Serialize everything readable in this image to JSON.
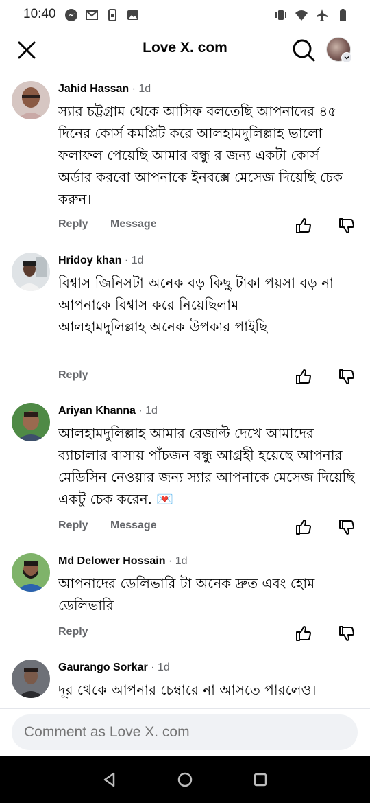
{
  "status_bar": {
    "time": "10:40"
  },
  "header": {
    "title": "Love X. com"
  },
  "comments": [
    {
      "name": "Jahid Hassan",
      "time": "1d",
      "text": "স্যার চট্টগ্রাম থেকে আসিফ বলতেছি আপনাদের ৪৫ দিনের কোর্স কমপ্লিট করে আলহামদুলিল্লাহ ভালো ফলাফল পেয়েছি আমার বন্ধু র জন্য একটা কোর্স অর্ডার করবো আপনাকে ইনবক্সে মেসেজ দিয়েছি চেক করুন।",
      "reply_label": "Reply",
      "message_label": "Message"
    },
    {
      "name": "Hridoy khan",
      "time": "1d",
      "text": "বিশ্বাস জিনিসটা অনেক বড় কিছু টাকা পয়সা বড় না\nআপনাকে বিশ্বাস করে নিয়েছিলাম\nআলহামদুলিল্লাহ অনেক উপকার পাইছি",
      "reply_label": "Reply"
    },
    {
      "name": "Ariyan Khanna",
      "time": "1d",
      "text": "আলহামদুলিল্লাহ আমার রেজাল্ট দেখে আমাদের ব্যাচালার বাসায় পাঁচজন বন্ধু আগ্রহী হয়েছে আপনার মেডিসিন নেওয়ার জন্য স্যার আপনাকে মেসেজ দিয়েছি একটু চেক করেন. 💌",
      "reply_label": "Reply",
      "message_label": "Message"
    },
    {
      "name": "Md Delower Hossain",
      "time": "1d",
      "text": "আপনাদের ডেলিভারি টা অনেক দ্রুত এবং হোম ডেলিভারি",
      "reply_label": "Reply"
    },
    {
      "name": "Gaurango Sorkar",
      "time": "1d",
      "text": "দূর থেকে আপনার চেম্বারে না আসতে পারলেও।"
    }
  ],
  "composer": {
    "placeholder": "Comment as Love X. com"
  },
  "icons": {
    "close": "close-icon",
    "search": "search-icon",
    "like": "thumbs-up-icon",
    "dislike": "thumbs-down-icon",
    "back": "back-triangle-icon",
    "home": "home-circle-icon",
    "recents": "recents-square-icon"
  }
}
